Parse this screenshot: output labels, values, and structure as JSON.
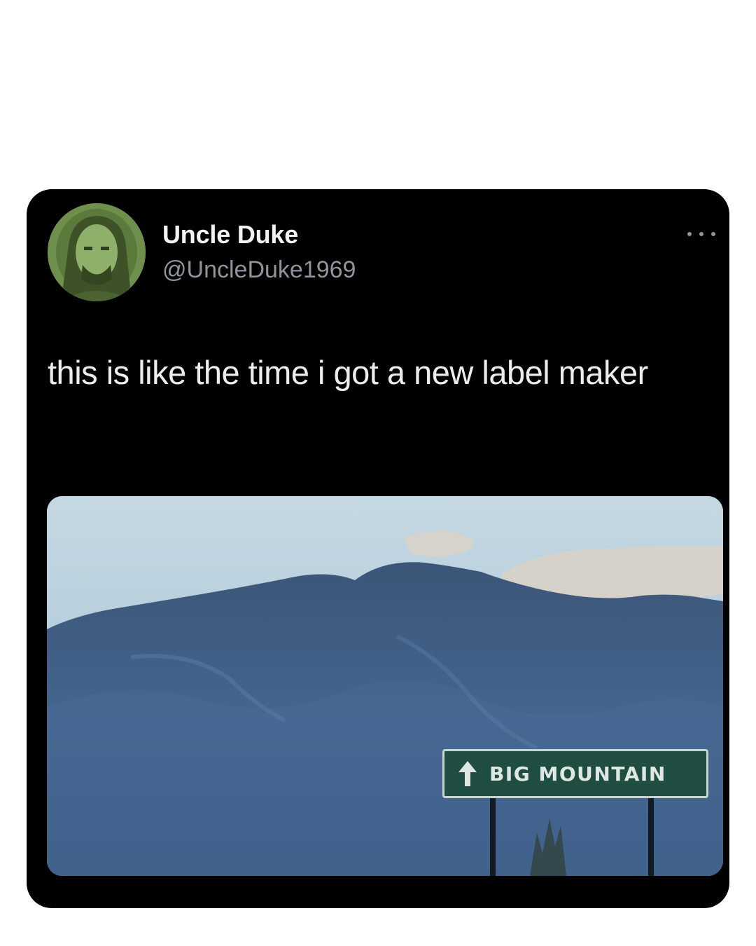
{
  "tweet": {
    "author": {
      "display_name": "Uncle Duke",
      "handle": "@UncleDuke1969",
      "avatar_icon": "profile-photo"
    },
    "menu_icon": "more-horizontal-icon",
    "text": "this is like the time i got a new label maker",
    "media": {
      "sign_text": "BIG MOUNTAIN",
      "sign_icon": "up-arrow-icon"
    }
  },
  "colors": {
    "background": "#ffffff",
    "card": "#000000",
    "name": "#f2f2f2",
    "secondary": "#8e959b",
    "sign_green": "#1f4d42",
    "sky": "#aac6d6",
    "mountain": "#3f5f88"
  }
}
